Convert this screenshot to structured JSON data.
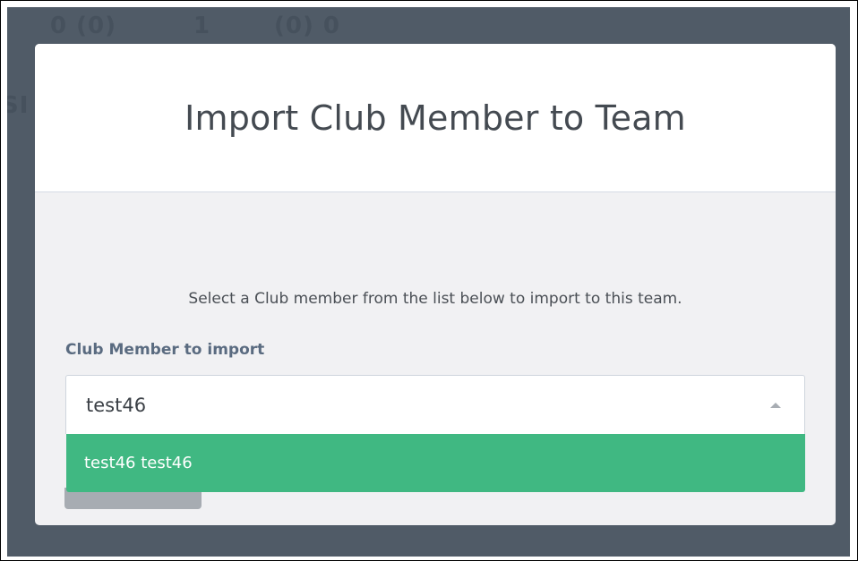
{
  "background": {
    "fragments": [
      "0 (0)",
      "1",
      "(0) 0",
      "SI"
    ]
  },
  "modal": {
    "title": "Import Club Member to Team",
    "instruction": "Select a Club member from the list below to import to this team.",
    "field_label": "Club Member to import",
    "select": {
      "value": "test46",
      "caret_icon": "caret-up-icon"
    },
    "dropdown": {
      "options": [
        {
          "label": "test46 test46",
          "highlighted": true
        }
      ]
    }
  },
  "colors": {
    "overlay": "#505b67",
    "option_highlight": "#40b882",
    "label": "#5a6b80"
  }
}
